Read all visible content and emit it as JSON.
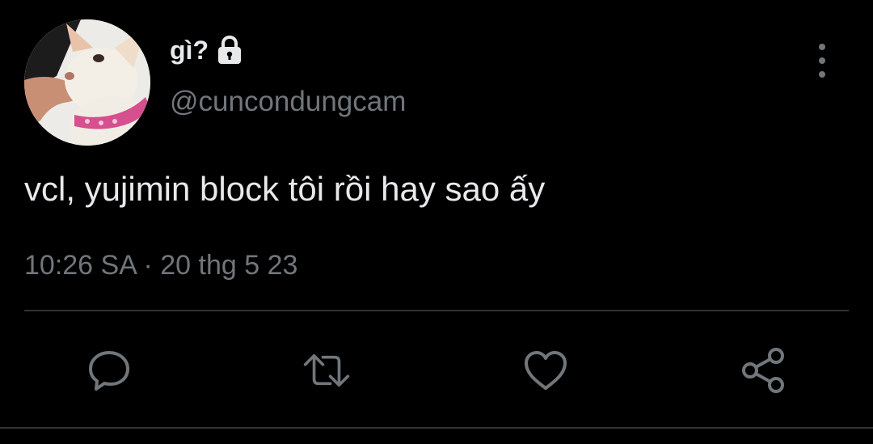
{
  "author": {
    "display_name": "gì?",
    "handle": "@cuncondungcam",
    "avatar": "chihuahua-photo",
    "protected_icon": "lock-icon"
  },
  "tweet": {
    "text": "vcl, yujimin block tôi rồi hay sao ấy",
    "time": "10:26 SA",
    "separator": "·",
    "date": "20 thg 5 23"
  },
  "actions": [
    {
      "name": "reply",
      "icon": "speech-bubble-icon"
    },
    {
      "name": "retweet",
      "icon": "retweet-icon"
    },
    {
      "name": "like",
      "icon": "heart-icon"
    },
    {
      "name": "share",
      "icon": "share-icon"
    }
  ],
  "colors": {
    "background": "#000000",
    "primary_text": "#e7e9ea",
    "secondary_text": "#71767b",
    "divider": "#2f3336"
  }
}
